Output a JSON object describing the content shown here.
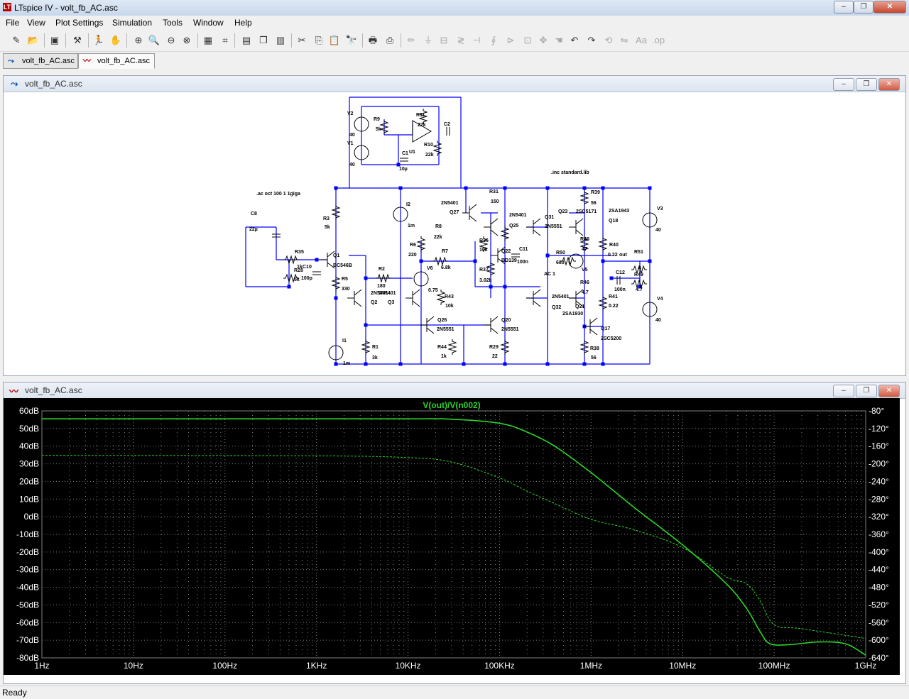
{
  "app": {
    "title": "LTspice IV - volt_fb_AC.asc",
    "logo": "LT"
  },
  "window_controls": {
    "minimize": "‒",
    "maximize": "❐",
    "close": "✕"
  },
  "menu": [
    "File",
    "View",
    "Plot Settings",
    "Simulation",
    "Tools",
    "Window",
    "Help"
  ],
  "toolbar": [
    {
      "icon": "new-schematic-icon",
      "glyph": "✎"
    },
    {
      "icon": "open-icon",
      "glyph": "📂"
    },
    {
      "icon": "save-icon",
      "glyph": "▣"
    },
    {
      "icon": "control-panel-icon",
      "glyph": "⚒"
    },
    {
      "icon": "run-icon",
      "glyph": "🏃"
    },
    {
      "icon": "halt-icon",
      "glyph": "✋"
    },
    {
      "icon": "zoom-in-icon",
      "glyph": "⊕"
    },
    {
      "icon": "zoom-pan-icon",
      "glyph": "🔍"
    },
    {
      "icon": "zoom-out-icon",
      "glyph": "⊖"
    },
    {
      "icon": "zoom-fit-icon",
      "glyph": "⊗"
    },
    {
      "icon": "autorange-icon",
      "glyph": "▦"
    },
    {
      "icon": "cursor-icon",
      "glyph": "⌗"
    },
    {
      "icon": "tile-horizontal-icon",
      "glyph": "▤"
    },
    {
      "icon": "cascade-icon",
      "glyph": "❐"
    },
    {
      "icon": "tile-vertical-icon",
      "glyph": "▥"
    },
    {
      "icon": "cut-icon",
      "glyph": "✂"
    },
    {
      "icon": "copy-icon",
      "glyph": "⎘"
    },
    {
      "icon": "paste-icon",
      "glyph": "📋"
    },
    {
      "icon": "find-icon",
      "glyph": "🔭"
    },
    {
      "icon": "print-setup-icon",
      "glyph": "🖶"
    },
    {
      "icon": "print-icon",
      "glyph": "⎙"
    },
    {
      "icon": "wire-icon",
      "glyph": "✏"
    },
    {
      "icon": "ground-icon",
      "glyph": "⏚"
    },
    {
      "icon": "label-icon",
      "glyph": "⊟"
    },
    {
      "icon": "resistor-icon",
      "glyph": "≷"
    },
    {
      "icon": "capacitor-icon",
      "glyph": "⊣"
    },
    {
      "icon": "inductor-icon",
      "glyph": "∮"
    },
    {
      "icon": "diode-icon",
      "glyph": "⊳"
    },
    {
      "icon": "component-icon",
      "glyph": "⊡"
    },
    {
      "icon": "move-icon",
      "glyph": "✥"
    },
    {
      "icon": "drag-icon",
      "glyph": "☚"
    },
    {
      "icon": "undo-icon",
      "glyph": "↶"
    },
    {
      "icon": "redo-icon",
      "glyph": "↷"
    },
    {
      "icon": "rotate-icon",
      "glyph": "⟲"
    },
    {
      "icon": "mirror-icon",
      "glyph": "⇋"
    },
    {
      "icon": "text-icon",
      "glyph": "Aa"
    },
    {
      "icon": "spice-directive-icon",
      "glyph": ".op"
    }
  ],
  "tabs": [
    {
      "label": "volt_fb_AC.asc",
      "icon": "schematic-icon"
    },
    {
      "label": "volt_fb_AC.asc",
      "icon": "waveform-icon"
    }
  ],
  "schematic": {
    "title": "volt_fb_AC.asc",
    "directives": [
      ".ac oct 100 1 1giga",
      ".inc standard.lib"
    ],
    "labels": [
      "V2",
      "40",
      "V1",
      "40",
      "R9",
      "5k",
      "R11",
      "22k",
      "C2",
      "C1",
      "10µ",
      "U1",
      "R10",
      "22k",
      "C8",
      "22µ",
      "R35",
      "1k",
      "R28",
      "5k",
      "C10",
      "100p",
      "R3",
      "5k",
      "Q1",
      "BC546B",
      "R5",
      "330",
      "R2",
      "180",
      "2N5401",
      "2N5401",
      "Q2",
      "Q3",
      "I2",
      "1m",
      "R6",
      "220",
      "V6",
      "0.75",
      "R7",
      "6.8k",
      "R8",
      "22k",
      "2N5401",
      "Q27",
      "R31",
      "150",
      "2N5401",
      "Q25",
      "R36",
      "10k",
      "Q22",
      "BD139",
      "C11",
      "100n",
      "R37",
      "3.02k",
      "R43",
      "10k",
      "Q26",
      "2N5551",
      "Q20",
      "2N5551",
      "R44",
      "1k",
      "R29",
      "22",
      "I1",
      "1m",
      "R1",
      "3k",
      "Q31",
      "2N5551",
      "R50",
      "680",
      "AC 1",
      "V5",
      "2N5401",
      "Q32",
      "Q23",
      "2SC5171",
      "R39",
      "56",
      "2SA1943",
      "Q18",
      "R45",
      "47",
      "R40",
      "0.22",
      "out",
      "R51",
      "4",
      "C12",
      "100n",
      "R49",
      "4.7",
      "R46",
      "4.7",
      "R41",
      "0.22",
      "Q21",
      "2SA1930",
      "Q17",
      "2SC5200",
      "R38",
      "56",
      "V3",
      "40",
      "V4",
      "40"
    ]
  },
  "plot": {
    "title": "volt_fb_AC.asc",
    "trace_title": "V(out)/V(n002)",
    "trace_color": "#2bd42b",
    "background": "#000000"
  },
  "chart_data": {
    "type": "line",
    "title": "V(out)/V(n002)",
    "x_scale": "log",
    "xlim": [
      1,
      1000000000
    ],
    "x_ticks": [
      "1Hz",
      "10Hz",
      "100Hz",
      "1KHz",
      "10KHz",
      "100KHz",
      "1MHz",
      "10MHz",
      "100MHz",
      "1GHz"
    ],
    "ylim": [
      -80,
      60
    ],
    "y_ticks": [
      "60dB",
      "50dB",
      "40dB",
      "30dB",
      "20dB",
      "10dB",
      "0dB",
      "-10dB",
      "-20dB",
      "-30dB",
      "-40dB",
      "-50dB",
      "-60dB",
      "-70dB",
      "-80dB"
    ],
    "y2lim": [
      -640,
      -80
    ],
    "y2_ticks": [
      "-80°",
      "-120°",
      "-160°",
      "-200°",
      "-240°",
      "-280°",
      "-320°",
      "-360°",
      "-400°",
      "-440°",
      "-480°",
      "-520°",
      "-560°",
      "-600°",
      "-640°"
    ],
    "grid": true,
    "series": [
      {
        "name": "V(out)/V(n002)",
        "quantity": "magnitude",
        "style": "solid",
        "x": [
          1,
          1000,
          10000,
          30000,
          100000,
          200000,
          400000,
          1000000,
          3000000,
          10000000,
          30000000,
          50000000,
          70000000,
          90000000,
          150000000,
          300000000,
          600000000,
          1000000000
        ],
        "y": [
          55.5,
          55.5,
          55.5,
          55.3,
          53.0,
          48.0,
          40.0,
          25.0,
          5.0,
          -16.0,
          -38.0,
          -52.0,
          -65.0,
          -72.0,
          -72.5,
          -71.0,
          -72.0,
          -78.5
        ]
      },
      {
        "name": "V(out)/V(n002)",
        "quantity": "phase",
        "style": "dashed",
        "x": [
          1,
          1000,
          10000,
          30000,
          100000,
          200000,
          400000,
          1000000,
          3000000,
          10000000,
          30000000,
          50000000,
          70000000,
          100000000,
          200000000,
          1000000000
        ],
        "y": [
          -181,
          -182,
          -186,
          -196,
          -232,
          -262,
          -290,
          -326,
          -350,
          -390,
          -456,
          -472,
          -510,
          -565,
          -574,
          -596
        ]
      }
    ]
  },
  "status": {
    "text": "Ready"
  }
}
